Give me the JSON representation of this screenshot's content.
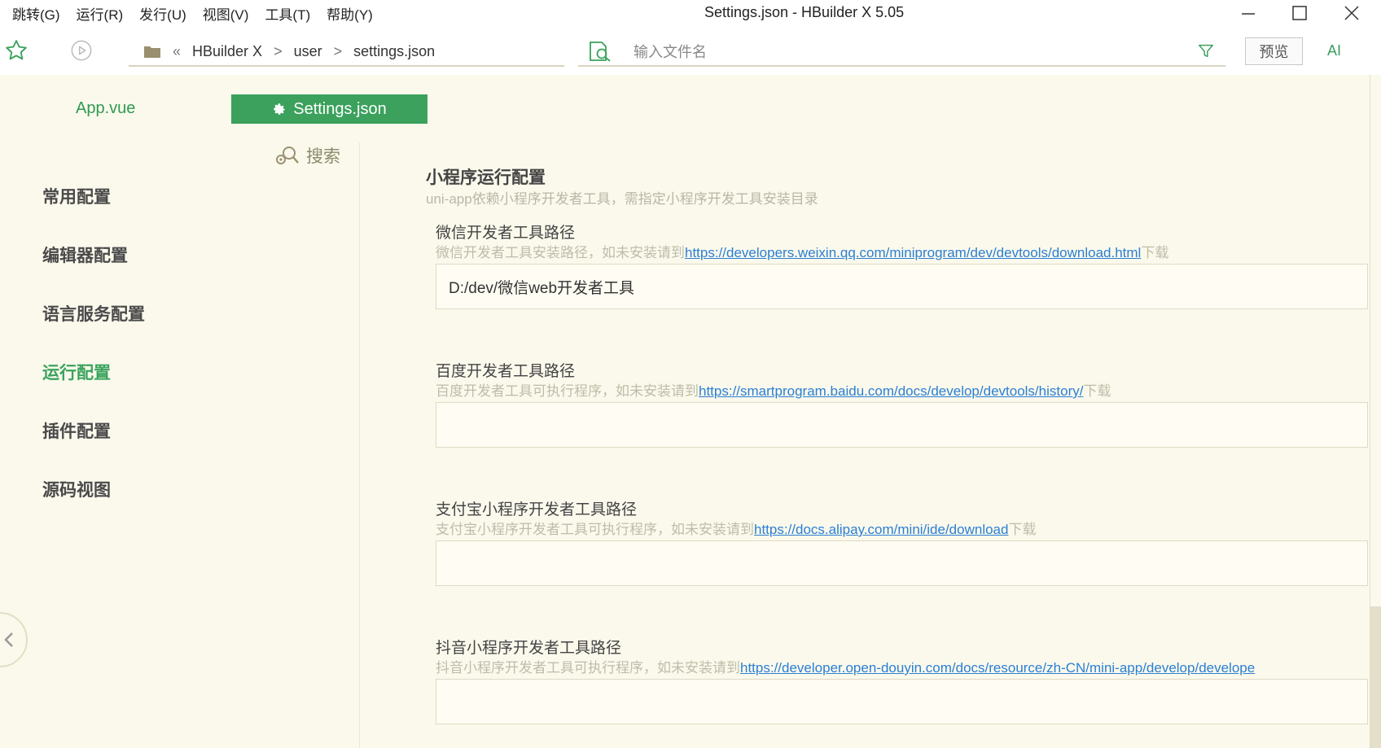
{
  "menu": [
    "跳转(G)",
    "运行(R)",
    "发行(U)",
    "视图(V)",
    "工具(T)",
    "帮助(Y)"
  ],
  "window_title": "Settings.json - HBuilder X 5.05",
  "toolbar": {
    "breadcrumb": [
      "HBuilder X",
      "user",
      "settings.json"
    ],
    "file_search_placeholder": "输入文件名",
    "preview_label": "预览",
    "ai_label": "AI"
  },
  "tabs": {
    "app": "App.vue",
    "settings": "Settings.json"
  },
  "settings_nav": {
    "search_label": "搜索",
    "items": [
      "常用配置",
      "编辑器配置",
      "语言服务配置",
      "运行配置",
      "插件配置",
      "源码视图"
    ],
    "active": "运行配置"
  },
  "section": {
    "title": "小程序运行配置",
    "description": "uni-app依赖小程序开发者工具，需指定小程序开发工具安装目录"
  },
  "fields": [
    {
      "label": "微信开发者工具路径",
      "help_prefix": "微信开发者工具安装路径，如未安装请到",
      "link": "https://developers.weixin.qq.com/miniprogram/dev/devtools/download.html",
      "help_suffix": "下载",
      "value": "D:/dev/微信web开发者工具"
    },
    {
      "label": "百度开发者工具路径",
      "help_prefix": "百度开发者工具可执行程序，如未安装请到",
      "link": "https://smartprogram.baidu.com/docs/develop/devtools/history/",
      "help_suffix": "下载",
      "value": ""
    },
    {
      "label": "支付宝小程序开发者工具路径",
      "help_prefix": "支付宝小程序开发者工具可执行程序，如未安装请到",
      "link": "https://docs.alipay.com/mini/ide/download",
      "help_suffix": "下载",
      "value": ""
    },
    {
      "label": "抖音小程序开发者工具路径",
      "help_prefix": "抖音小程序开发者工具可执行程序，如未安装请到",
      "link": "https://developer.open-douyin.com/docs/resource/zh-CN/mini-app/develop/develope",
      "help_suffix": "",
      "value": ""
    }
  ],
  "colors": {
    "accent": "#3ba15c",
    "background": "#fbf9ec",
    "link": "#2a7fd4"
  }
}
